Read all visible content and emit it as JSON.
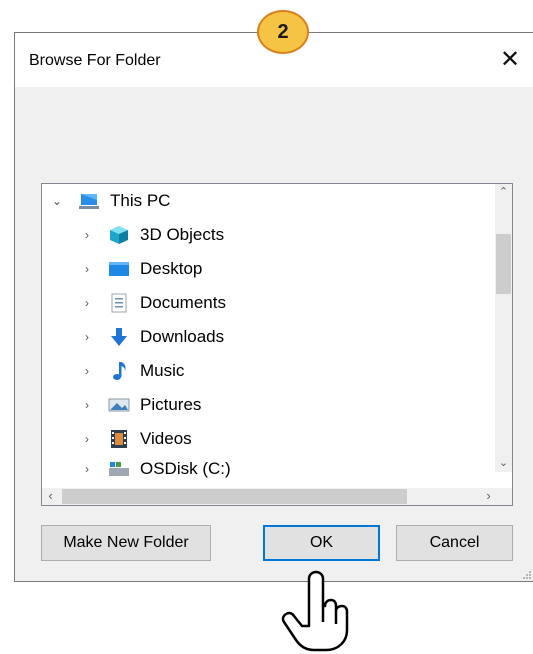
{
  "step_badge": "2",
  "dialog": {
    "title": "Browse For Folder"
  },
  "tree": {
    "root": {
      "label": "This PC",
      "icon": "monitor-icon"
    },
    "items": [
      {
        "label": "3D Objects",
        "icon": "cube-icon"
      },
      {
        "label": "Desktop",
        "icon": "desktop-icon"
      },
      {
        "label": "Documents",
        "icon": "documents-icon"
      },
      {
        "label": "Downloads",
        "icon": "download-arrow-icon"
      },
      {
        "label": "Music",
        "icon": "music-note-icon"
      },
      {
        "label": "Pictures",
        "icon": "pictures-icon"
      },
      {
        "label": "Videos",
        "icon": "videos-icon"
      },
      {
        "label": "OSDisk (C:)",
        "icon": "drive-icon"
      }
    ]
  },
  "buttons": {
    "make_new_folder": "Make New Folder",
    "ok": "OK",
    "cancel": "Cancel"
  },
  "colors": {
    "accent": "#0078d7",
    "badge_fill": "#f6c445",
    "badge_border": "#d9801c"
  }
}
